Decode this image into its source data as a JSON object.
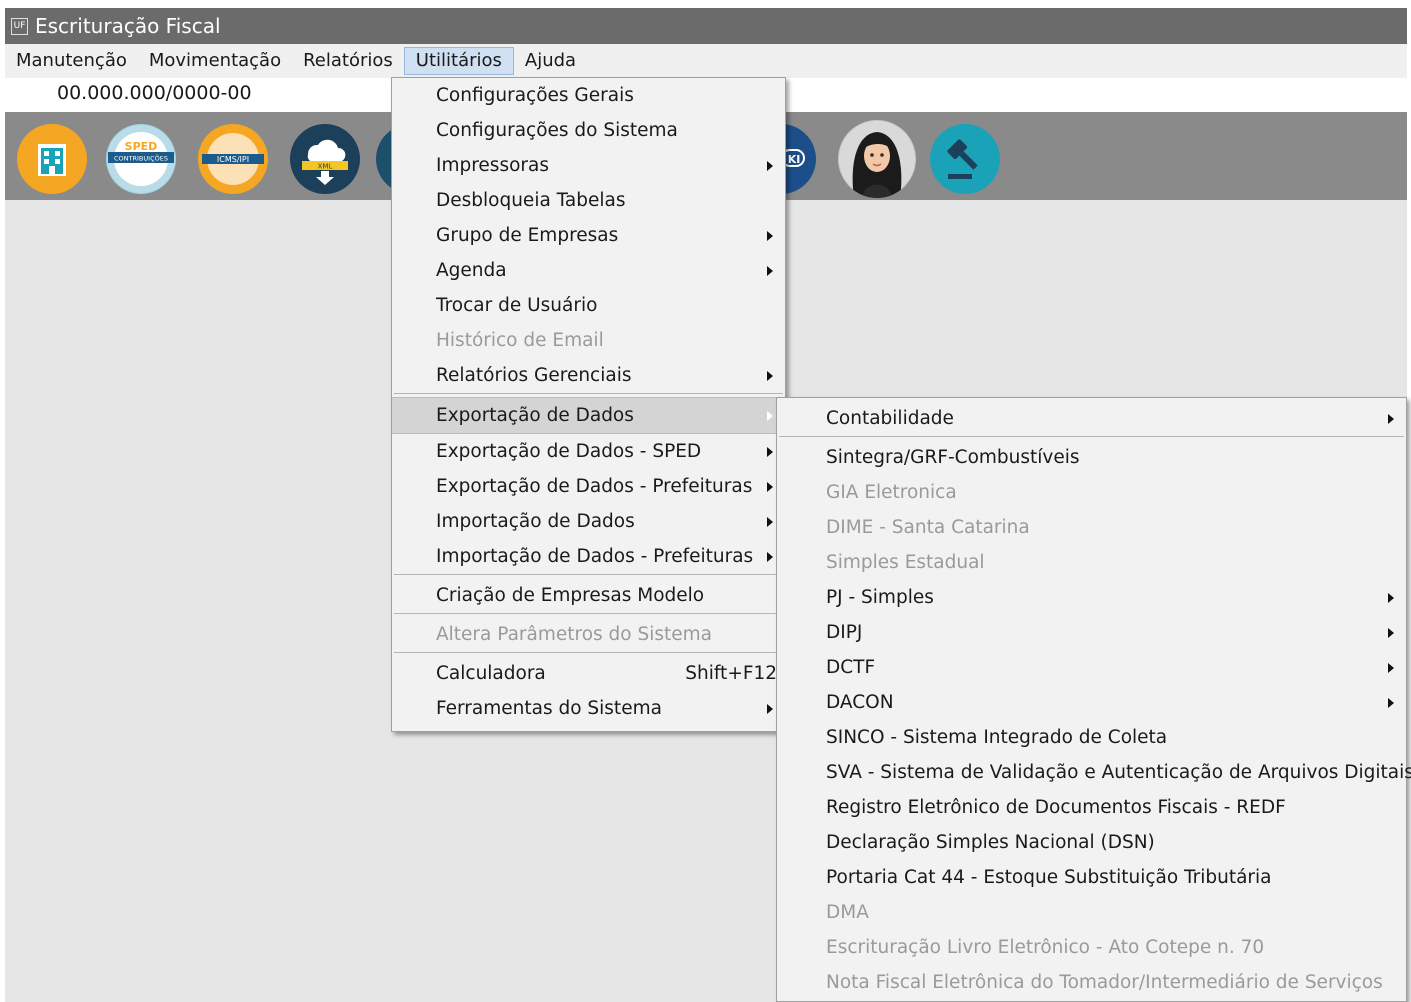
{
  "window": {
    "title": "Escrituração Fiscal",
    "app_icon_label": "UF"
  },
  "menubar": {
    "items": [
      {
        "label": "Manutenção"
      },
      {
        "label": "Movimentação"
      },
      {
        "label": "Relatórios"
      },
      {
        "label": "Utilitários",
        "active": true
      },
      {
        "label": "Ajuda"
      }
    ]
  },
  "company": {
    "cnpj": "00.000.000/0000-00"
  },
  "toolbar": {
    "icons": [
      {
        "name": "company-building-icon"
      },
      {
        "name": "sped-contribuicoes-icon",
        "label_top": "SPED",
        "label_bottom": "CONTRIBUIÇÕES"
      },
      {
        "name": "sped-icms-ipi-icon",
        "label": "ICMS/IPI"
      },
      {
        "name": "xml-cloud-download-icon",
        "label": "XML"
      },
      {
        "name": "partially-hidden-icon"
      },
      {
        "name": "wiki-icon",
        "label": "KI"
      },
      {
        "name": "assistant-avatar-icon"
      },
      {
        "name": "gavel-legislation-icon"
      }
    ]
  },
  "utilities_menu": {
    "items": [
      {
        "label": "Configurações Gerais"
      },
      {
        "label": "Configurações do Sistema"
      },
      {
        "label": "Impressoras"
      },
      {
        "label": "Desbloqueia Tabelas"
      },
      {
        "label": "Grupo de Empresas"
      },
      {
        "label": "Agenda"
      },
      {
        "label": "Trocar de Usuário"
      },
      {
        "label": "Histórico de Email"
      },
      {
        "label": "Relatórios Gerenciais"
      },
      {
        "label": "Exportação de Dados"
      },
      {
        "label": "Exportação de Dados - SPED"
      },
      {
        "label": "Exportação de Dados - Prefeituras"
      },
      {
        "label": "Importação de Dados"
      },
      {
        "label": "Importação de Dados - Prefeituras"
      },
      {
        "label": "Criação de Empresas Modelo"
      },
      {
        "label": "Altera Parâmetros do Sistema"
      },
      {
        "label": "Calculadora",
        "shortcut": "Shift+F12"
      },
      {
        "label": "Ferramentas do Sistema"
      }
    ]
  },
  "export_menu": {
    "items": [
      {
        "label": "Contabilidade"
      },
      {
        "label": "Sintegra/GRF-Combustíveis"
      },
      {
        "label": "GIA Eletronica"
      },
      {
        "label": "DIME - Santa Catarina"
      },
      {
        "label": "Simples Estadual"
      },
      {
        "label": "PJ - Simples"
      },
      {
        "label": "DIPJ"
      },
      {
        "label": "DCTF"
      },
      {
        "label": "DACON"
      },
      {
        "label": "SINCO - Sistema Integrado de Coleta"
      },
      {
        "label": "SVA - Sistema de Validação e Autenticação de Arquivos Digitais"
      },
      {
        "label": "Registro Eletrônico de Documentos Fiscais - REDF"
      },
      {
        "label": "Declaração Simples Nacional (DSN)"
      },
      {
        "label": "Portaria Cat 44 - Estoque Substituição Tributária"
      },
      {
        "label": "DMA"
      },
      {
        "label": "Escrituração Livro Eletrônico - Ato Cotepe n. 70"
      },
      {
        "label": "Nota Fiscal Eletrônica do Tomador/Intermediário de Serviços"
      }
    ]
  },
  "colors": {
    "titlebar": "#6b6b6b",
    "toolbar": "#8a8a8a",
    "menu_bg": "#f2f2f2",
    "highlight": "#d4d4d4",
    "disabled_text": "#9a9a9a",
    "orange": "#f5a623",
    "teal": "#1aa3b8",
    "navy": "#1c3f5a"
  }
}
